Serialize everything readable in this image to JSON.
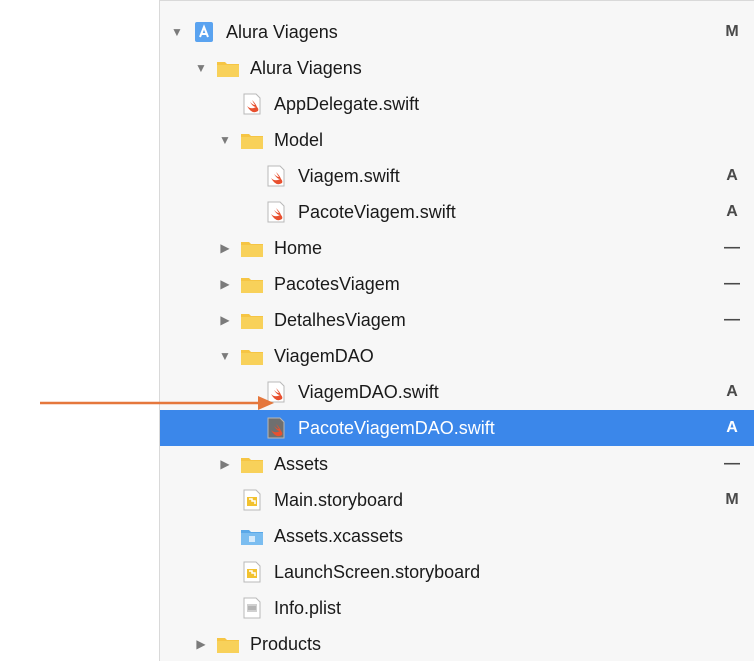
{
  "navigator": {
    "rows": [
      {
        "label": "Alura Viagens",
        "type": "project",
        "indent": 0,
        "disclosure": "open",
        "status": "M",
        "icon": "xcode-project-icon"
      },
      {
        "label": "Alura Viagens",
        "type": "folder",
        "indent": 1,
        "disclosure": "open",
        "status": "",
        "icon": "folder-icon"
      },
      {
        "label": "AppDelegate.swift",
        "type": "swift",
        "indent": 2,
        "disclosure": "",
        "status": "",
        "icon": "swift-file-icon"
      },
      {
        "label": "Model",
        "type": "folder",
        "indent": 2,
        "disclosure": "open",
        "status": "",
        "icon": "folder-icon"
      },
      {
        "label": "Viagem.swift",
        "type": "swift",
        "indent": 3,
        "disclosure": "",
        "status": "A",
        "icon": "swift-file-icon"
      },
      {
        "label": "PacoteViagem.swift",
        "type": "swift",
        "indent": 3,
        "disclosure": "",
        "status": "A",
        "icon": "swift-file-icon"
      },
      {
        "label": "Home",
        "type": "folder",
        "indent": 2,
        "disclosure": "closed",
        "status": "—",
        "icon": "folder-icon"
      },
      {
        "label": "PacotesViagem",
        "type": "folder",
        "indent": 2,
        "disclosure": "closed",
        "status": "—",
        "icon": "folder-icon"
      },
      {
        "label": "DetalhesViagem",
        "type": "folder",
        "indent": 2,
        "disclosure": "closed",
        "status": "—",
        "icon": "folder-icon"
      },
      {
        "label": "ViagemDAO",
        "type": "folder",
        "indent": 2,
        "disclosure": "open",
        "status": "",
        "icon": "folder-icon"
      },
      {
        "label": "ViagemDAO.swift",
        "type": "swift",
        "indent": 3,
        "disclosure": "",
        "status": "A",
        "icon": "swift-file-icon"
      },
      {
        "label": "PacoteViagemDAO.swift",
        "type": "swift",
        "indent": 3,
        "disclosure": "",
        "status": "A",
        "icon": "swift-file-icon",
        "selected": true
      },
      {
        "label": "Assets",
        "type": "folder",
        "indent": 2,
        "disclosure": "closed",
        "status": "—",
        "icon": "folder-icon"
      },
      {
        "label": "Main.storyboard",
        "type": "storyboard",
        "indent": 2,
        "disclosure": "",
        "status": "M",
        "icon": "storyboard-icon"
      },
      {
        "label": "Assets.xcassets",
        "type": "xcassets",
        "indent": 2,
        "disclosure": "",
        "status": "",
        "icon": "xcassets-icon"
      },
      {
        "label": "LaunchScreen.storyboard",
        "type": "storyboard",
        "indent": 2,
        "disclosure": "",
        "status": "",
        "icon": "storyboard-icon"
      },
      {
        "label": "Info.plist",
        "type": "plist",
        "indent": 2,
        "disclosure": "",
        "status": "",
        "icon": "plist-icon"
      },
      {
        "label": "Products",
        "type": "folder",
        "indent": 1,
        "disclosure": "closed",
        "status": "",
        "icon": "folder-icon"
      }
    ]
  },
  "colors": {
    "selection": "#3b87ea",
    "folder": "#f6c544",
    "swift": "#e8502f",
    "arrow": "#e5773c"
  }
}
